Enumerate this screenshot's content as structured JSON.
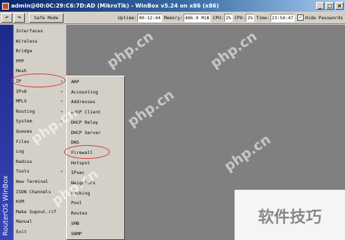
{
  "window": {
    "title": "admin@00:0C:29:C6:7D:AD (MikroTik) - WinBox v5.24 on x86 (x86)",
    "minimize": "_",
    "maximize": "□",
    "close": "×"
  },
  "toolbar": {
    "undo_icon": "↶",
    "redo_icon": "↷",
    "safe_mode_label": "Safe Mode",
    "uptime_label": "Uptime:",
    "uptime_value": "00:12:44",
    "memory_label": "Memory:",
    "memory_value": "486.9 MiB",
    "cpu_label": "CPU:",
    "cpu_value": "2%",
    "cpu2_label": "CPU:",
    "cpu2_value": "2%",
    "time_label": "Time:",
    "time_value": "23:54:47",
    "hide_passwords_checked": "✓",
    "hide_passwords_label": "Hide Passwords"
  },
  "sidebar": {
    "brand": "RouterOS WinBox"
  },
  "main_menu": [
    {
      "label": "Interfaces"
    },
    {
      "label": "Wireless"
    },
    {
      "label": "Bridge"
    },
    {
      "label": "PPP"
    },
    {
      "label": "Mesh"
    },
    {
      "label": "IP",
      "arrow": "▸"
    },
    {
      "label": "IPv6",
      "arrow": "▸"
    },
    {
      "label": "MPLS",
      "arrow": "▸"
    },
    {
      "label": "Routing",
      "arrow": "▸"
    },
    {
      "label": "System",
      "arrow": "▸"
    },
    {
      "label": "Queues"
    },
    {
      "label": "Files"
    },
    {
      "label": "Log"
    },
    {
      "label": "Radius"
    },
    {
      "label": "Tools",
      "arrow": "▸"
    },
    {
      "label": "New Terminal"
    },
    {
      "label": "ISDN Channels"
    },
    {
      "label": "KVM"
    },
    {
      "label": "Make Supout.rif"
    },
    {
      "label": "Manual"
    },
    {
      "label": "Exit"
    }
  ],
  "ip_submenu": [
    {
      "label": "ARP"
    },
    {
      "label": "Accounting"
    },
    {
      "label": "Addresses"
    },
    {
      "label": "DHCP Client"
    },
    {
      "label": "DHCP Relay"
    },
    {
      "label": "DHCP Server"
    },
    {
      "label": "DNS"
    },
    {
      "label": "Firewall"
    },
    {
      "label": "Hotspot"
    },
    {
      "label": "IPsec"
    },
    {
      "label": "Neighbors"
    },
    {
      "label": "Packing"
    },
    {
      "label": "Pool"
    },
    {
      "label": "Routes"
    },
    {
      "label": "SMB"
    },
    {
      "label": "SNMP"
    }
  ],
  "watermarks": [
    "php.cn",
    "php.cn",
    "php.cn",
    "php.cn",
    "php.cn",
    "php.cn"
  ],
  "badge_text": "软件技巧",
  "colors": {
    "annotation_red": "#c8322a",
    "sidebar_blue": "#1e2a8a",
    "workspace_gray": "#808080"
  }
}
